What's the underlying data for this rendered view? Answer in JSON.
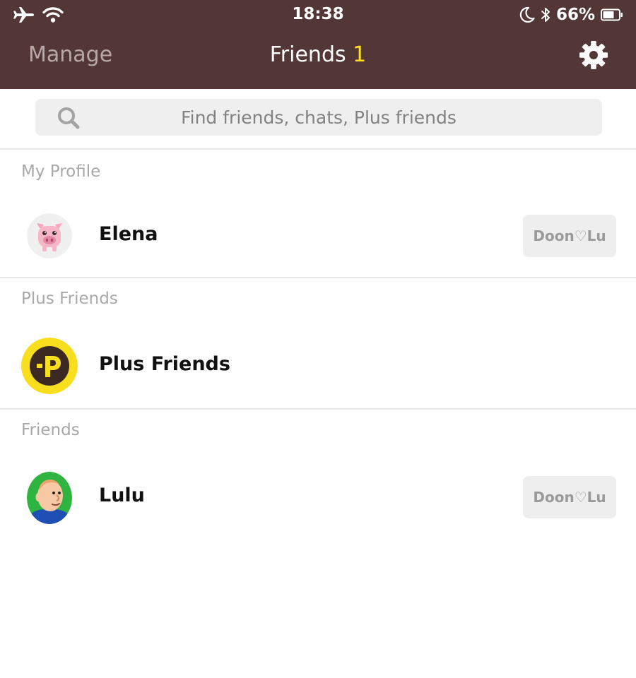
{
  "status_bar": {
    "time": "18:38",
    "battery": "66%",
    "icons": [
      "airplane-icon",
      "wifi-icon",
      "moon-icon",
      "bluetooth-icon",
      "battery-icon"
    ]
  },
  "nav": {
    "manage_label": "Manage",
    "title": "Friends",
    "count": "1",
    "settings_icon": "gear-icon"
  },
  "search": {
    "placeholder": "Find friends, chats, Plus friends",
    "icon": "search-icon"
  },
  "my_profile": {
    "section_label": "My Profile",
    "name": "Elena",
    "status": "Doon♡Lu",
    "avatar": "pig-avatar"
  },
  "plus_friends": {
    "section_label": "Plus Friends",
    "name": "Plus Friends",
    "avatar": "plus-friends-logo"
  },
  "friends": {
    "section_label": "Friends",
    "items": [
      {
        "name": "Lulu",
        "status": "Doon♡Lu",
        "avatar": "cartoon-boy-avatar"
      }
    ]
  },
  "colors": {
    "header_bg": "#523736",
    "count_yellow": "#ffe11a",
    "plus_logo_yellow": "#f9de1d",
    "plus_logo_brown": "#3c2a22"
  }
}
